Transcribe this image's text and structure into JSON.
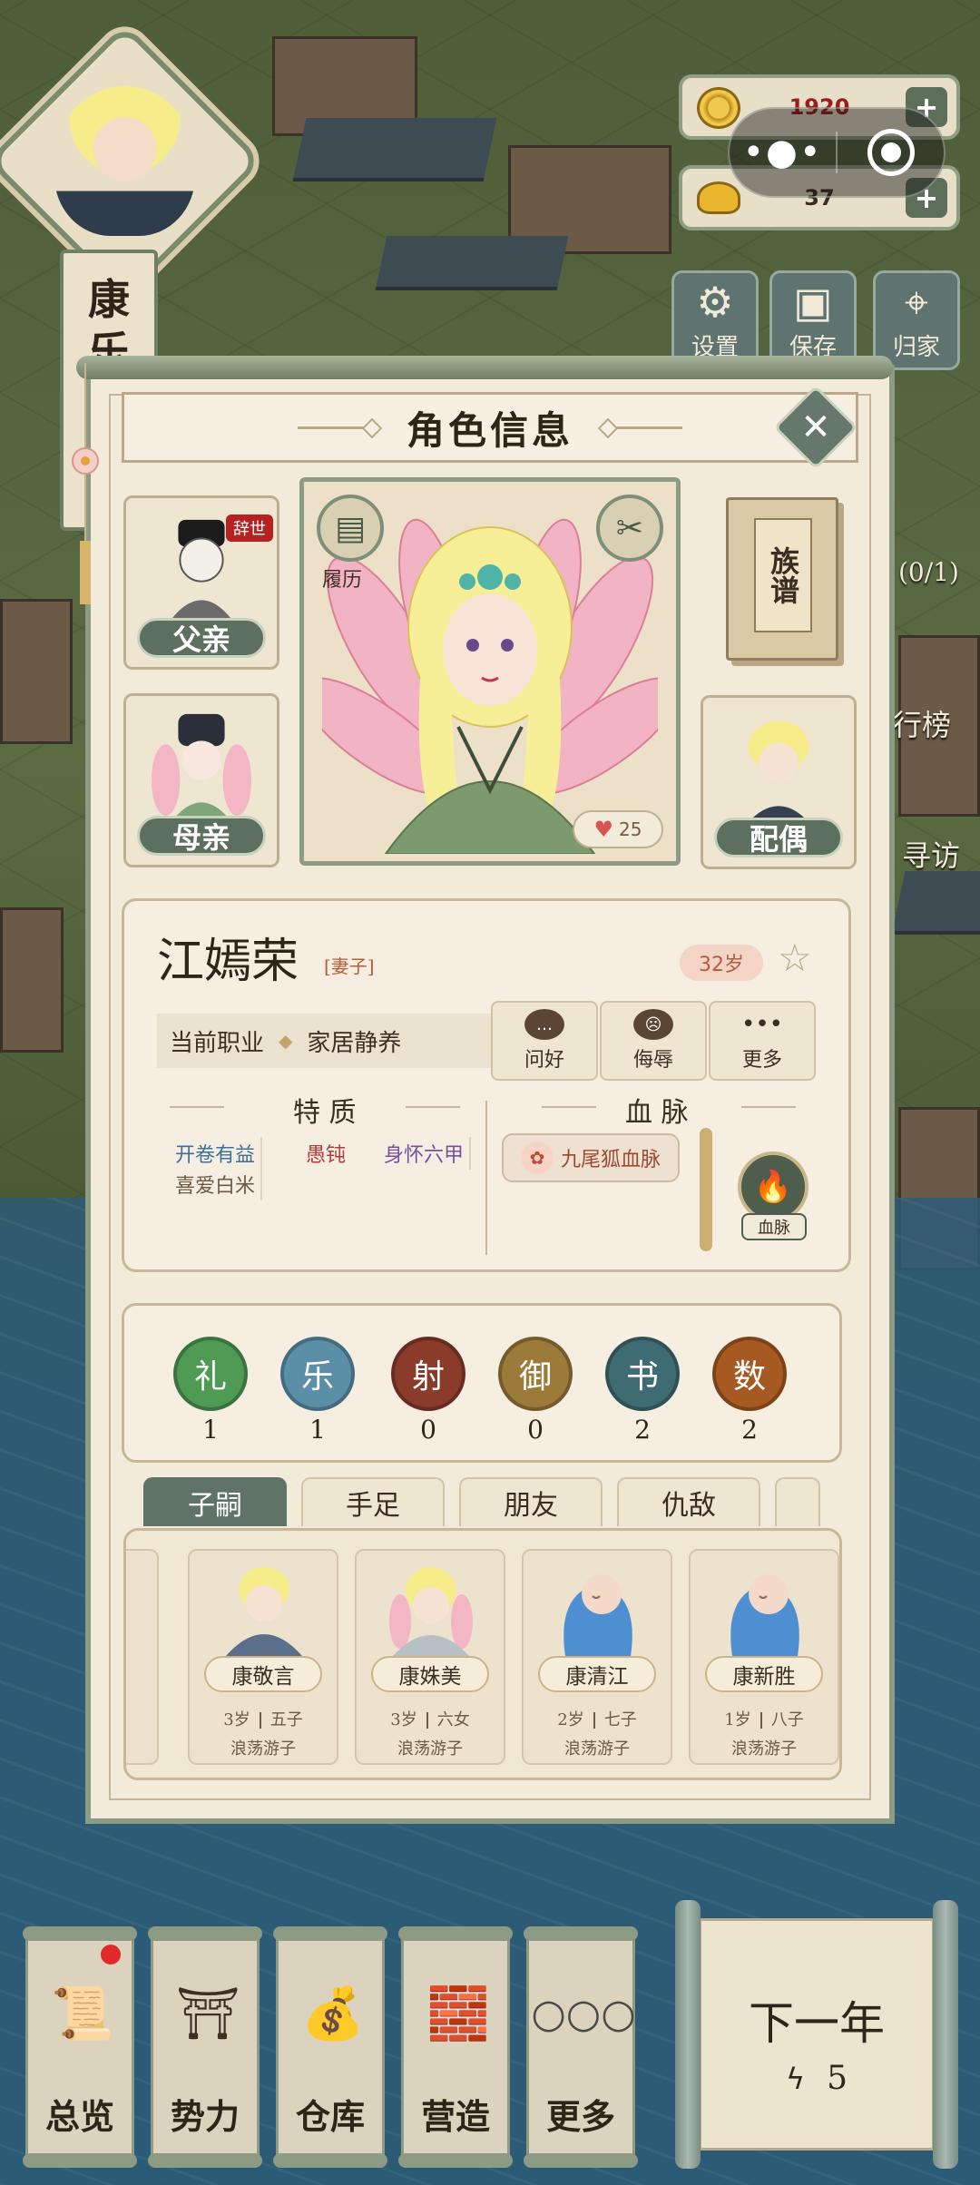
{
  "player": {
    "name_chars": [
      "康",
      "乐"
    ]
  },
  "resources": {
    "coins": "1920",
    "ingots": "37"
  },
  "system_buttons": [
    {
      "label": "设置",
      "icon": "gear-icon"
    },
    {
      "label": "保存",
      "icon": "save-icon"
    },
    {
      "label": "归家",
      "icon": "location-pin-icon"
    }
  ],
  "side_labels": {
    "progress": "(0/1)",
    "ranking": "行榜",
    "visit": "寻访"
  },
  "panel": {
    "title": "角色信息",
    "resume_label": "履历",
    "genealogy_label": "族谱",
    "affection": "25",
    "family": {
      "father": "父亲",
      "father_badge": "辞世",
      "mother": "母亲",
      "spouse": "配偶"
    },
    "character": {
      "name": "江嫣荣",
      "relation": "[妻子]",
      "age": "32岁",
      "occupation_label": "当前职业",
      "occupation": "家居静养"
    },
    "actions": [
      {
        "label": "问好",
        "icon": "chat-bubble-icon"
      },
      {
        "label": "侮辱",
        "icon": "angry-face-icon"
      },
      {
        "label": "更多",
        "icon": "more-dots-icon"
      }
    ],
    "traits_title": "特 质",
    "traits": [
      "开卷有益",
      "愚钝",
      "身怀六甲",
      "喜爱白米"
    ],
    "bloodline_title": "血 脉",
    "bloodline_item": "九尾狐血脉",
    "bloodline_button": "血脉",
    "skills": [
      {
        "name": "礼",
        "value": "1",
        "color": "#4f9a55"
      },
      {
        "name": "乐",
        "value": "1",
        "color": "#5b8fa8"
      },
      {
        "name": "射",
        "value": "0",
        "color": "#8a3b2a"
      },
      {
        "name": "御",
        "value": "0",
        "color": "#9c7a3a"
      },
      {
        "name": "书",
        "value": "2",
        "color": "#3f6b72"
      },
      {
        "name": "数",
        "value": "2",
        "color": "#a65a22"
      }
    ],
    "tabs": [
      "子嗣",
      "手足",
      "朋友",
      "仇敌"
    ],
    "children": [
      {
        "name": "康敬言",
        "age": "3岁",
        "rank": "五子",
        "status": "浪荡游子"
      },
      {
        "name": "康姝美",
        "age": "3岁",
        "rank": "六女",
        "status": "浪荡游子"
      },
      {
        "name": "康清江",
        "age": "2岁",
        "rank": "七子",
        "status": "浪荡游子"
      },
      {
        "name": "康新胜",
        "age": "1岁",
        "rank": "八子",
        "status": "浪荡游子"
      }
    ]
  },
  "bottom_nav": [
    {
      "label": "总览",
      "icon": "scroll-brush-icon"
    },
    {
      "label": "势力",
      "icon": "palace-icon"
    },
    {
      "label": "仓库",
      "icon": "money-bag-icon"
    },
    {
      "label": "营造",
      "icon": "trowel-bricks-icon"
    },
    {
      "label": "更多",
      "icon": "more-dots-icon"
    }
  ],
  "next_year": {
    "label": "下一年",
    "energy": "5"
  }
}
